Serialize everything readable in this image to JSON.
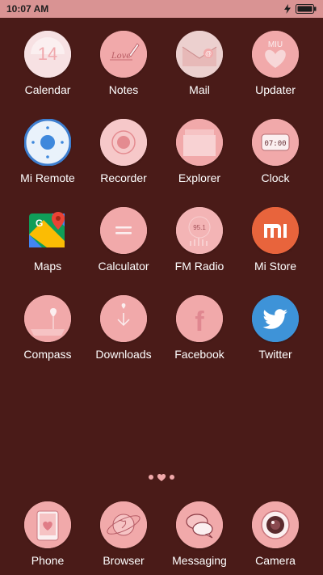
{
  "status_bar": {
    "time": "10:07 AM",
    "icons": [
      "charging-bolt-icon",
      "battery-icon"
    ]
  },
  "apps": [
    {
      "label": "Calendar",
      "icon": "calendar-icon",
      "badge": "14"
    },
    {
      "label": "Notes",
      "icon": "notes-icon",
      "badge": "Love"
    },
    {
      "label": "Mail",
      "icon": "mail-icon"
    },
    {
      "label": "Updater",
      "icon": "updater-icon",
      "badge": "MIU"
    },
    {
      "label": "Mi Remote",
      "icon": "remote-icon"
    },
    {
      "label": "Recorder",
      "icon": "recorder-icon"
    },
    {
      "label": "Explorer",
      "icon": "folder-icon"
    },
    {
      "label": "Clock",
      "icon": "clock-icon",
      "badge": "07:00"
    },
    {
      "label": "Maps",
      "icon": "maps-icon"
    },
    {
      "label": "Calculator",
      "icon": "calculator-icon"
    },
    {
      "label": "FM Radio",
      "icon": "radio-icon",
      "badge": "95.1"
    },
    {
      "label": "Mi Store",
      "icon": "mi-store-icon",
      "badge": "mi"
    },
    {
      "label": "Compass",
      "icon": "compass-icon"
    },
    {
      "label": "Downloads",
      "icon": "download-icon"
    },
    {
      "label": "Facebook",
      "icon": "facebook-icon",
      "badge": "f"
    },
    {
      "label": "Twitter",
      "icon": "twitter-icon"
    }
  ],
  "dock": [
    {
      "label": "Phone",
      "icon": "phone-icon"
    },
    {
      "label": "Browser",
      "icon": "browser-icon"
    },
    {
      "label": "Messaging",
      "icon": "messaging-icon"
    },
    {
      "label": "Camera",
      "icon": "camera-icon"
    }
  ],
  "colors": {
    "background": "#4a1b18",
    "icon_pink": "#f1a9aa",
    "status_bar": "#d99393",
    "mi_orange": "#e8643c",
    "twitter_blue": "#3e93d8"
  }
}
